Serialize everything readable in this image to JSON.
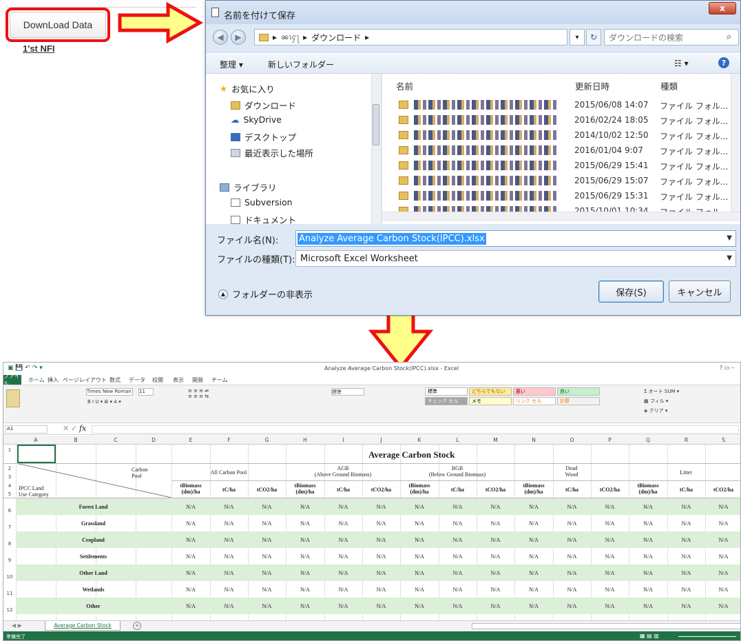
{
  "webpage": {
    "download_button": "DownLoad Data",
    "link": "1'st NFI"
  },
  "dialog": {
    "title": "名前を付けて保存",
    "close": "x",
    "breadcrumb_user": "ၼၤႁႃ",
    "breadcrumb_folder": "ダウンロード",
    "search_placeholder": "ダウンロードの検索",
    "toolbar": {
      "organize": "整理 ▾",
      "new_folder": "新しいフォルダー"
    },
    "nav": [
      {
        "label": "お気に入り",
        "icon": "star-icon"
      },
      {
        "label": "ダウンロード",
        "icon": "download-folder-icon"
      },
      {
        "label": "SkyDrive",
        "icon": "cloud-icon"
      },
      {
        "label": "デスクトップ",
        "icon": "desktop-icon"
      },
      {
        "label": "最近表示した場所",
        "icon": "recent-places-icon"
      },
      {
        "label": "ライブラリ",
        "icon": "library-icon"
      },
      {
        "label": "Subversion",
        "icon": "document-icon"
      },
      {
        "label": "ドキュメント",
        "icon": "document-icon"
      }
    ],
    "columns": {
      "name": "名前",
      "modified": "更新日時",
      "type": "種類"
    },
    "files": [
      {
        "date": "2015/06/08 14:07",
        "type": "ファイル フォル..."
      },
      {
        "date": "2016/02/24 18:05",
        "type": "ファイル フォル..."
      },
      {
        "date": "2014/10/02 12:50",
        "type": "ファイル フォル..."
      },
      {
        "date": "2016/01/04 9:07",
        "type": "ファイル フォル..."
      },
      {
        "date": "2015/06/29 15:41",
        "type": "ファイル フォル..."
      },
      {
        "date": "2015/06/29 15:07",
        "type": "ファイル フォル..."
      },
      {
        "date": "2015/06/29 15:31",
        "type": "ファイル フォル..."
      },
      {
        "date": "2015/10/01 10:34",
        "type": "ファイル フォル..."
      }
    ],
    "filename_label": "ファイル名(N):",
    "filename_value": "Analyze Average Carbon Stock(IPCC).xlsx",
    "filetype_label": "ファイルの種類(T):",
    "filetype_value": "Microsoft Excel Worksheet",
    "hide_folders": "フォルダーの非表示",
    "save_button": "保存(S)",
    "cancel_button": "キャンセル"
  },
  "excel": {
    "window_title": "Analyze Average Carbon Stock(IPCC).xlsx - Excel",
    "tabs": [
      "ファイル",
      "ホーム",
      "挿入",
      "ページレイアウト",
      "数式",
      "データ",
      "校閲",
      "表示",
      "開発",
      "チーム"
    ],
    "font_name": "Times New Roman",
    "font_size": "11",
    "number_format": "標準",
    "styles": [
      {
        "label": "標準",
        "bg": "#ffffff",
        "fg": "#000000"
      },
      {
        "label": "どちらでもない",
        "bg": "#ffeb9c",
        "fg": "#9c6500"
      },
      {
        "label": "悪い",
        "bg": "#ffc7ce",
        "fg": "#9c0006"
      },
      {
        "label": "良い",
        "bg": "#c6efce",
        "fg": "#006100"
      },
      {
        "label": "チェック セル",
        "bg": "#a5a5a5",
        "fg": "#ffffff"
      },
      {
        "label": "メモ",
        "bg": "#ffffcc",
        "fg": "#000000"
      },
      {
        "label": "リンク セル",
        "bg": "#ffffff",
        "fg": "#fa7d00"
      },
      {
        "label": "計算",
        "bg": "#f2f2f2",
        "fg": "#fa7d00"
      }
    ],
    "namebox": "A1",
    "fx": "fx",
    "columns": [
      "A",
      "B",
      "C",
      "D",
      "E",
      "F",
      "G",
      "H",
      "I",
      "J",
      "K",
      "L",
      "M",
      "N",
      "O",
      "P",
      "Q",
      "R",
      "S"
    ],
    "rows": [
      "1",
      "2",
      "3",
      "4",
      "5",
      "6",
      "7",
      "8",
      "9",
      "10",
      "11",
      "12",
      "13"
    ],
    "sheet_title": "Average Carbon Stock",
    "carbon_pool_label": "Carbon\nPool",
    "land_category_label": "IPCC Land\nUse Category",
    "pools": [
      {
        "name": "All Carbon Pool"
      },
      {
        "name": "AGB\n(Above Ground Biomass)"
      },
      {
        "name": "BGB\n(Below Ground Biomass)"
      },
      {
        "name": "Dead\nWood"
      },
      {
        "name": "Litter"
      }
    ],
    "units": [
      "tBiomass\n(dm)/ha",
      "tC/ha",
      "tCO2/ha"
    ],
    "categories": [
      "Forest Land",
      "Grassland",
      "Cropland",
      "Settlements",
      "Other Land",
      "Wetlands",
      "Other"
    ],
    "cell_value": "N/A",
    "sheet_tab": "Average Carbon Stock",
    "status_text": "準備完了"
  },
  "colors": {
    "arrow_fill": "#ffff8a",
    "arrow_stroke": "#ee1111",
    "excel_green": "#217346",
    "row_green": "#dcefd8"
  }
}
